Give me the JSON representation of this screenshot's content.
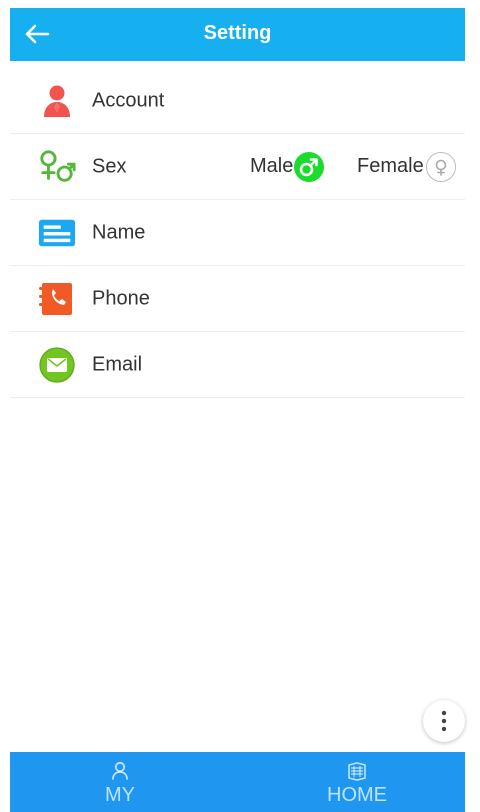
{
  "header": {
    "title": "Setting",
    "back_icon": "arrow-left-icon"
  },
  "settings": [
    {
      "label": "Account",
      "icon": "account-icon"
    },
    {
      "label": "Sex",
      "icon": "sex-icon"
    },
    {
      "label": "Name",
      "icon": "name-card-icon"
    },
    {
      "label": "Phone",
      "icon": "phone-book-icon"
    },
    {
      "label": "Email",
      "icon": "email-icon"
    }
  ],
  "sex": {
    "male_label": "Male",
    "female_label": "Female",
    "selected": "Male"
  },
  "bottom_nav": {
    "my_label": "MY",
    "home_label": "HOME",
    "my_icon": "person-icon",
    "home_icon": "home-icon"
  },
  "colors": {
    "header_bg": "#16b0f0",
    "nav_bg": "#1f97f0",
    "male_selected": "#19dc2c",
    "account_icon": "#f2534f",
    "sex_icon": "#55b73a",
    "name_icon": "#1da7f2",
    "phone_icon": "#f05a24",
    "email_icon": "#73c521"
  },
  "fab": {
    "icon": "more-vertical-icon"
  }
}
